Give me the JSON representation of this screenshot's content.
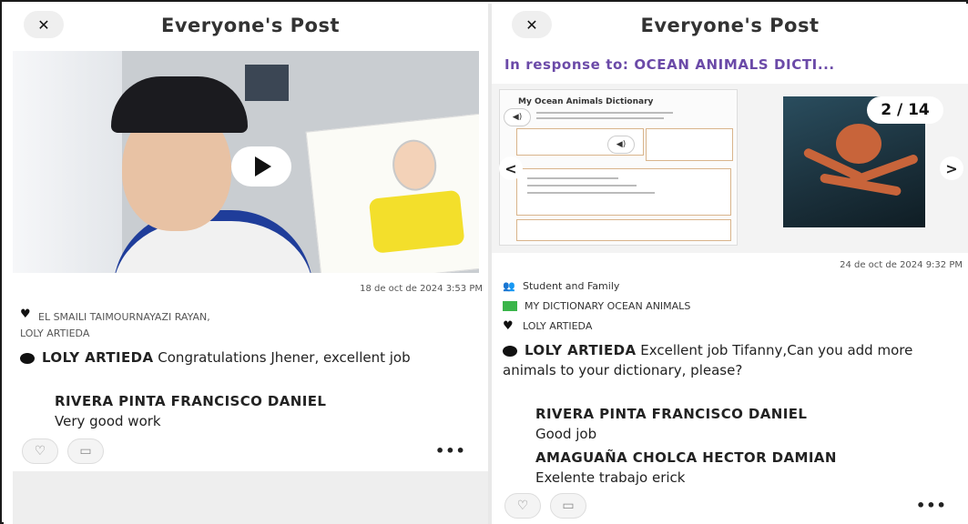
{
  "left_post": {
    "header": {
      "close_label": "✕",
      "title": "Everyone's Post"
    },
    "date": "18 de oct de 2024 3:53 PM",
    "likes": [
      "EL SMAILI TAIMOURNAYAZI RAYAN,",
      "LOLY ARTIEDA"
    ],
    "comment": {
      "author": "LOLY ARTIEDA",
      "text": "Congratulations Jhener, excellent job"
    },
    "replies": [
      {
        "author": "RIVERA PINTA FRANCISCO DANIEL",
        "text": "Very good work"
      }
    ],
    "more_label": "•••"
  },
  "right_post": {
    "header": {
      "close_label": "✕",
      "title": "Everyone's Post"
    },
    "response": "In response to: OCEAN ANIMALS DICTI...",
    "carousel": {
      "counter": "2 / 14",
      "doc_title": "My Ocean Animals Dictionary",
      "prev_label": "<",
      "next_label": ">"
    },
    "date": "24 de oct de 2024 9:32 PM",
    "tags": [
      "Student and Family",
      "MY DICTIONARY OCEAN ANIMALS"
    ],
    "likes": [
      "LOLY ARTIEDA"
    ],
    "comment": {
      "author": "LOLY ARTIEDA",
      "text": "Excellent job Tifanny,Can you add more animals to your dictionary, please?"
    },
    "replies": [
      {
        "author": "RIVERA PINTA FRANCISCO DANIEL",
        "text": "Good job"
      },
      {
        "author": "AMAGUAÑA CHOLCA HECTOR DAMIAN",
        "text": "Exelente trabajo erick"
      }
    ],
    "more_label": "•••"
  },
  "colors": {
    "accent_purple": "#6b4aa8",
    "tag_green": "#3ab54a"
  }
}
